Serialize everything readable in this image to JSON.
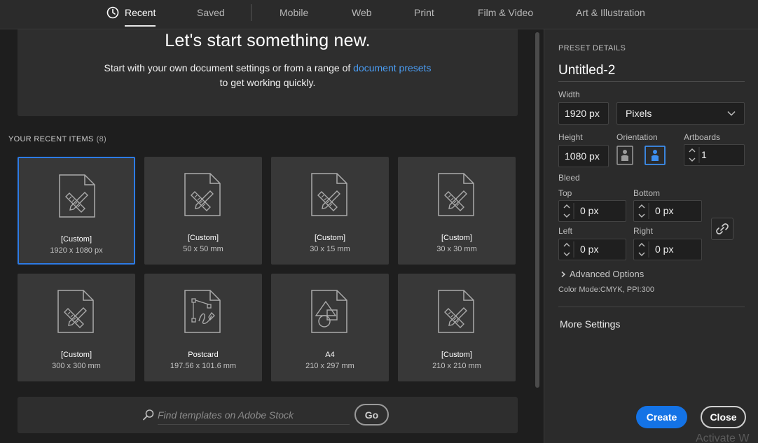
{
  "nav": {
    "tabs": [
      {
        "label": "Recent",
        "active": true
      },
      {
        "label": "Saved"
      },
      {
        "label": "Mobile"
      },
      {
        "label": "Web"
      },
      {
        "label": "Print"
      },
      {
        "label": "Film & Video"
      },
      {
        "label": "Art & Illustration"
      }
    ]
  },
  "hero": {
    "title": "Let's start something new.",
    "subtitle_before": "Start with your own document settings or from a range of ",
    "subtitle_link": "document presets",
    "subtitle_after": "to get working quickly."
  },
  "recent": {
    "label": "YOUR RECENT ITEMS",
    "count": "(8)",
    "items": [
      {
        "name": "[Custom]",
        "size": "1920 x 1080 px",
        "icon": "document-ruler-pencil-icon",
        "selected": true
      },
      {
        "name": "[Custom]",
        "size": "50 x 50 mm",
        "icon": "document-ruler-pencil-icon"
      },
      {
        "name": "[Custom]",
        "size": "30 x 15 mm",
        "icon": "document-ruler-pencil-icon"
      },
      {
        "name": "[Custom]",
        "size": "30 x 30 mm",
        "icon": "document-ruler-pencil-icon"
      },
      {
        "name": "[Custom]",
        "size": "300 x 300 mm",
        "icon": "document-ruler-pencil-icon"
      },
      {
        "name": "Postcard",
        "size": "197.56 x 101.6 mm",
        "icon": "document-pen-path-icon"
      },
      {
        "name": "A4",
        "size": "210 x 297 mm",
        "icon": "document-shapes-icon"
      },
      {
        "name": "[Custom]",
        "size": "210 x 210 mm",
        "icon": "document-ruler-pencil-icon"
      }
    ]
  },
  "search": {
    "placeholder": "Find templates on Adobe Stock",
    "go_label": "Go"
  },
  "preset": {
    "section_label": "PRESET DETAILS",
    "name": "Untitled-2",
    "width_label": "Width",
    "width_value": "1920 px",
    "units": "Pixels",
    "height_label": "Height",
    "height_value": "1080 px",
    "orientation_label": "Orientation",
    "artboards_label": "Artboards",
    "artboards_value": "1",
    "bleed_label": "Bleed",
    "top_label": "Top",
    "top_value": "0 px",
    "bottom_label": "Bottom",
    "bottom_value": "0 px",
    "left_label": "Left",
    "left_value": "0 px",
    "right_label": "Right",
    "right_value": "0 px",
    "advanced_label": "Advanced Options",
    "color_mode": "Color Mode:CMYK, PPI:300",
    "more_settings": "More Settings",
    "create_label": "Create",
    "close_label": "Close"
  },
  "watermark": "Activate W",
  "colors": {
    "accent": "#1473e6",
    "selected_border": "#2d7be5",
    "link": "#4a9cf2",
    "panel": "#2b2b2b",
    "background": "#1e1e1e",
    "card": "#383838"
  }
}
